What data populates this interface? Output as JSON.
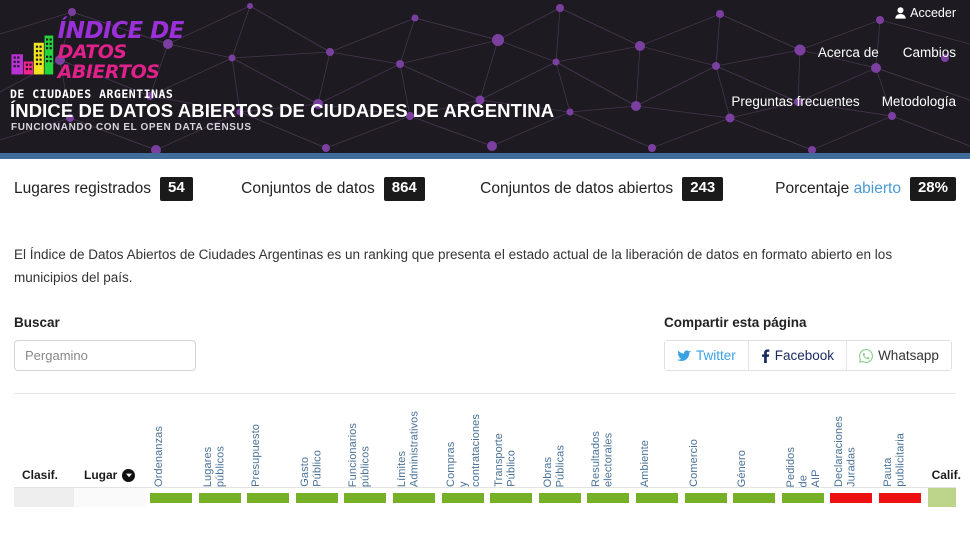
{
  "hero": {
    "logo": {
      "line1": "ÍNDICE DE",
      "line2": "DATOS ABIERTOS",
      "line3": "DE  CIUDADES  ARGENTINAS",
      "color_line1": "#9b30d9",
      "color_line2": "#e0218a"
    },
    "title": "ÍNDICE DE DATOS ABIERTOS DE CIUDADES DE ARGENTINA",
    "subtitle": "FUNCIONANDO CON EL OPEN DATA CENSUS",
    "login": "Acceder",
    "login_icon": "user-icon",
    "nav_row1": [
      "Acerca de",
      "Cambios"
    ],
    "nav_row2": [
      "Preguntas frecuentes",
      "Metodología"
    ],
    "background_color": "#1d1a21",
    "node_color": "#7b3fa0",
    "rule_color": "#3f6c99"
  },
  "stats": [
    {
      "label": "Lugares registrados",
      "value": "54"
    },
    {
      "label": "Conjuntos de datos",
      "value": "864"
    },
    {
      "label": "Conjuntos de datos abiertos",
      "value": "243"
    },
    {
      "label": "Porcentaje ",
      "label_highlight": "abierto",
      "value": "28%",
      "highlight_color": "#4a9ad4"
    }
  ],
  "intro": "El Índice de Datos Abiertos de Ciudades Argentinas es un ranking que presenta el estado actual de la liberación de datos en formato abierto en los municipios del país.",
  "search": {
    "heading": "Buscar",
    "placeholder": "Pergamino",
    "value": ""
  },
  "share": {
    "heading": "Compartir esta página",
    "buttons": [
      {
        "label": "Twitter",
        "icon": "twitter-bird-icon",
        "color": "#3aa2e2"
      },
      {
        "label": "Facebook",
        "icon": "facebook-f-icon",
        "color": "#1a2a5e"
      },
      {
        "label": "Whatsapp",
        "icon": "whatsapp-icon",
        "color": "#6ec06e"
      }
    ]
  },
  "table": {
    "fixed_headers": [
      {
        "label": "Clasif.",
        "sort_icon": null
      },
      {
        "label": "Lugar",
        "sort_icon": "sort-down-circle-icon"
      }
    ],
    "final_header": "Calif.",
    "dataset_columns": [
      {
        "lines": [
          "Ordenanzas"
        ]
      },
      {
        "lines": [
          "Lugares",
          "públicos"
        ]
      },
      {
        "lines": [
          "Presupuesto"
        ]
      },
      {
        "lines": [
          "Gasto",
          "Público"
        ]
      },
      {
        "lines": [
          "Funcionarios",
          "públicos"
        ]
      },
      {
        "lines": [
          "Límites",
          "Administrativos"
        ]
      },
      {
        "lines": [
          "Compras",
          "y",
          "contrataciones"
        ]
      },
      {
        "lines": [
          "Transporte",
          "Público"
        ]
      },
      {
        "lines": [
          "Obras",
          "Públicas"
        ]
      },
      {
        "lines": [
          "Resultados",
          "electorales"
        ]
      },
      {
        "lines": [
          "Ambiente"
        ]
      },
      {
        "lines": [
          "Comercio"
        ]
      },
      {
        "lines": [
          "Género"
        ]
      },
      {
        "lines": [
          "Pedidos",
          "de",
          "AIP"
        ]
      },
      {
        "lines": [
          "Declaraciones",
          "Juradas"
        ]
      },
      {
        "lines": [
          "Pauta",
          "publicitaria"
        ]
      }
    ],
    "row": {
      "cell_statuses": [
        "green",
        "green",
        "green",
        "green",
        "green",
        "green",
        "green",
        "green",
        "green",
        "green",
        "green",
        "green",
        "green",
        "green",
        "red",
        "red"
      ],
      "final_cell_status": "lightgreen"
    },
    "status_colors": {
      "green": "#76b027",
      "red": "#ee1111",
      "lightgreen": "#bdd58a",
      "header_text": "#4a7298"
    }
  }
}
